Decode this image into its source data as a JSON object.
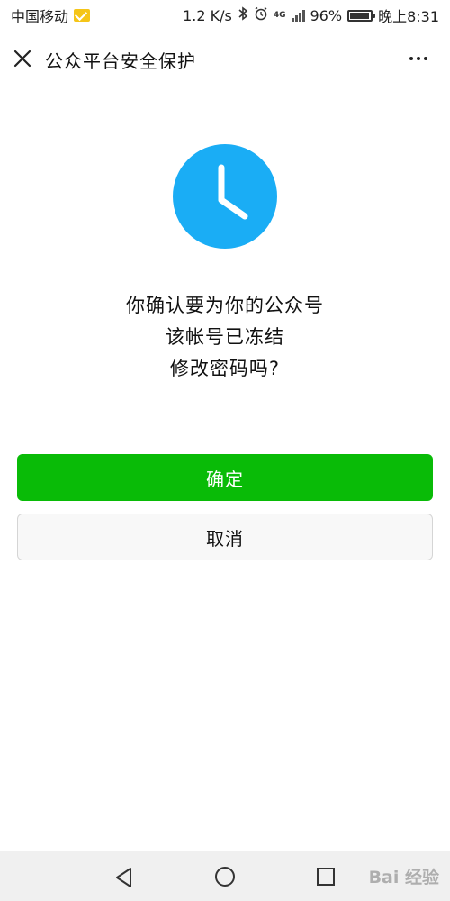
{
  "status_bar": {
    "carrier": "中国移动",
    "speed": "1.2 K/s",
    "network": "4G",
    "battery": "96%",
    "time": "晚上8:31"
  },
  "nav": {
    "title": "公众平台安全保护"
  },
  "message": {
    "line1": "你确认要为你的公众号",
    "line2": "该帐号已冻结",
    "line3": "修改密码吗?"
  },
  "buttons": {
    "confirm": "确定",
    "cancel": "取消"
  },
  "watermark": {
    "text": "Bai 经验"
  },
  "colors": {
    "accent_green": "#09bb07",
    "clock_blue": "#1aadf5"
  },
  "icons": {
    "close": "close-icon",
    "more": "more-icon",
    "clock": "clock-icon",
    "back": "back-icon",
    "home": "home-icon",
    "recent": "recent-apps-icon"
  }
}
